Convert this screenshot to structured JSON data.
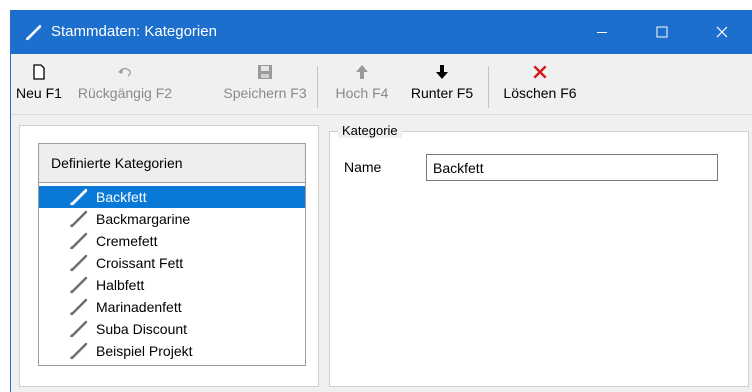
{
  "window": {
    "title": "Stammdaten: Kategorien",
    "title_color": "#1d6fce"
  },
  "toolbar": {
    "new_label": "Neu F1",
    "undo_label": "Rückgängig F2",
    "save_label": "Speichern F3",
    "up_label": "Hoch F4",
    "down_label": "Runter F5",
    "delete_label": "Löschen F6"
  },
  "list": {
    "header": "Definierte Kategorien",
    "selection_color": "#0a78d7",
    "items": [
      {
        "label": "Backfett",
        "selected": true
      },
      {
        "label": "Backmargarine",
        "selected": false
      },
      {
        "label": "Cremefett",
        "selected": false
      },
      {
        "label": "Croissant Fett",
        "selected": false
      },
      {
        "label": "Halbfett",
        "selected": false
      },
      {
        "label": "Marinadenfett",
        "selected": false
      },
      {
        "label": "Suba Discount",
        "selected": false
      },
      {
        "label": "Beispiel Projekt",
        "selected": false
      }
    ]
  },
  "detail": {
    "group_title": "Kategorie",
    "name_label": "Name",
    "name_value": "Backfett"
  }
}
